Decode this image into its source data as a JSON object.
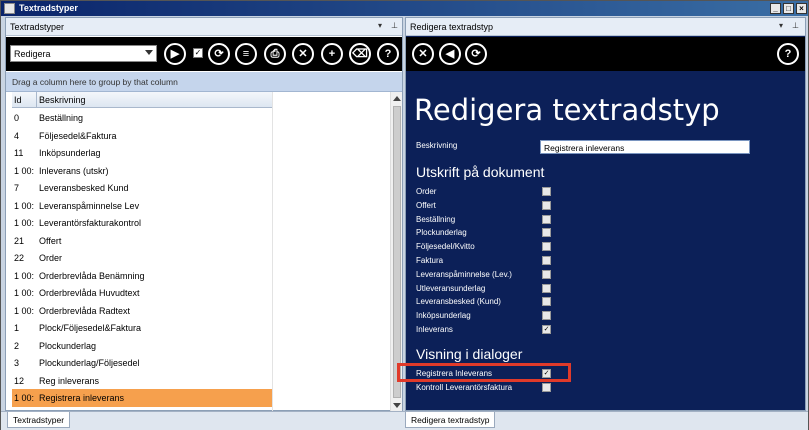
{
  "window": {
    "title": "Textradstyper"
  },
  "left": {
    "header": "Textradstyper",
    "combo_value": "Redigera",
    "group_hint": "Drag a column here to group by that column",
    "columns": {
      "id": "Id",
      "desc": "Beskrivning"
    },
    "rows": [
      {
        "id": "0",
        "desc": "Beställning"
      },
      {
        "id": "4",
        "desc": "Följesedel&Faktura"
      },
      {
        "id": "11",
        "desc": "Inköpsunderlag"
      },
      {
        "id": "1 00:",
        "desc": "Inleverans (utskr)"
      },
      {
        "id": "7",
        "desc": "Leveransbesked Kund"
      },
      {
        "id": "1 00:",
        "desc": "Leveranspåminnelse Lev"
      },
      {
        "id": "1 00:",
        "desc": "Leverantörsfakturakontrol"
      },
      {
        "id": "21",
        "desc": "Offert"
      },
      {
        "id": "22",
        "desc": "Order"
      },
      {
        "id": "1 00:",
        "desc": "Orderbrevlåda Benämning"
      },
      {
        "id": "1 00:",
        "desc": "Orderbrevlåda Huvudtext"
      },
      {
        "id": "1 00:",
        "desc": "Orderbrevlåda Radtext"
      },
      {
        "id": "1",
        "desc": "Plock/Följesedel&Faktura"
      },
      {
        "id": "2",
        "desc": "Plockunderlag"
      },
      {
        "id": "3",
        "desc": "Plockunderlag/Följesedel"
      },
      {
        "id": "12",
        "desc": "Reg inleverans"
      },
      {
        "id": "1 00:",
        "desc": "Registrera inleverans"
      }
    ]
  },
  "right": {
    "header": "Redigera textradstyp",
    "page_title": "Redigera textradstyp",
    "beskrivning_label": "Beskrivning",
    "beskrivning_value": "Registrera inleverans",
    "section_print": "Utskrift på dokument",
    "print_items": [
      {
        "label": "Order",
        "checked": false
      },
      {
        "label": "Offert",
        "checked": false
      },
      {
        "label": "Beställning",
        "checked": false
      },
      {
        "label": "Plockunderlag",
        "checked": false
      },
      {
        "label": "Följesedel/Kvitto",
        "checked": false
      },
      {
        "label": "Faktura",
        "checked": false
      },
      {
        "label": "Leveranspåminnelse (Lev.)",
        "checked": false
      },
      {
        "label": "Utleveransunderlag",
        "checked": false
      },
      {
        "label": "Leveransbesked (Kund)",
        "checked": false
      },
      {
        "label": "Inköpsunderlag",
        "checked": false
      },
      {
        "label": "Inleverans",
        "checked": true
      }
    ],
    "section_dialog": "Visning i dialoger",
    "dialog_items": [
      {
        "label": "Registrera Inleverans",
        "checked": true
      },
      {
        "label": "Kontroll Leverantörsfaktura",
        "checked": false
      }
    ]
  },
  "tabs": {
    "left": "Textradstyper",
    "right": "Redigera textradstyp"
  },
  "colors": {
    "accent_selection": "#f6a04d",
    "form_bg": "#0c2058",
    "highlight": "#e03a2a"
  }
}
